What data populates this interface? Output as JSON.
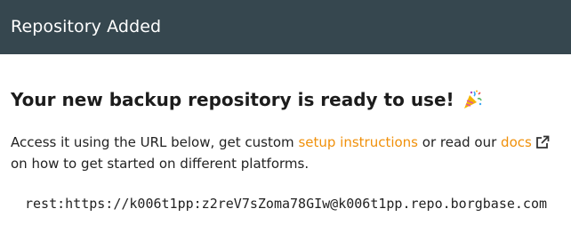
{
  "header": {
    "title": "Repository Added",
    "background_color": "#36474f"
  },
  "main": {
    "headline": "Your new backup repository is ready to use!",
    "headline_icon": "party-popper-icon",
    "description": {
      "part1": "Access it using the URL below, get custom ",
      "setup_link_label": "setup instructions",
      "part2": " or read our ",
      "docs_link_label": "docs",
      "docs_icon": "external-link-icon",
      "part3": " on how to get started on different platforms."
    },
    "repo_url": "rest:https://k006t1pp:z2reV7sZoma78GIw@k006t1pp.repo.borgbase.com",
    "link_color": "#f0900a"
  }
}
